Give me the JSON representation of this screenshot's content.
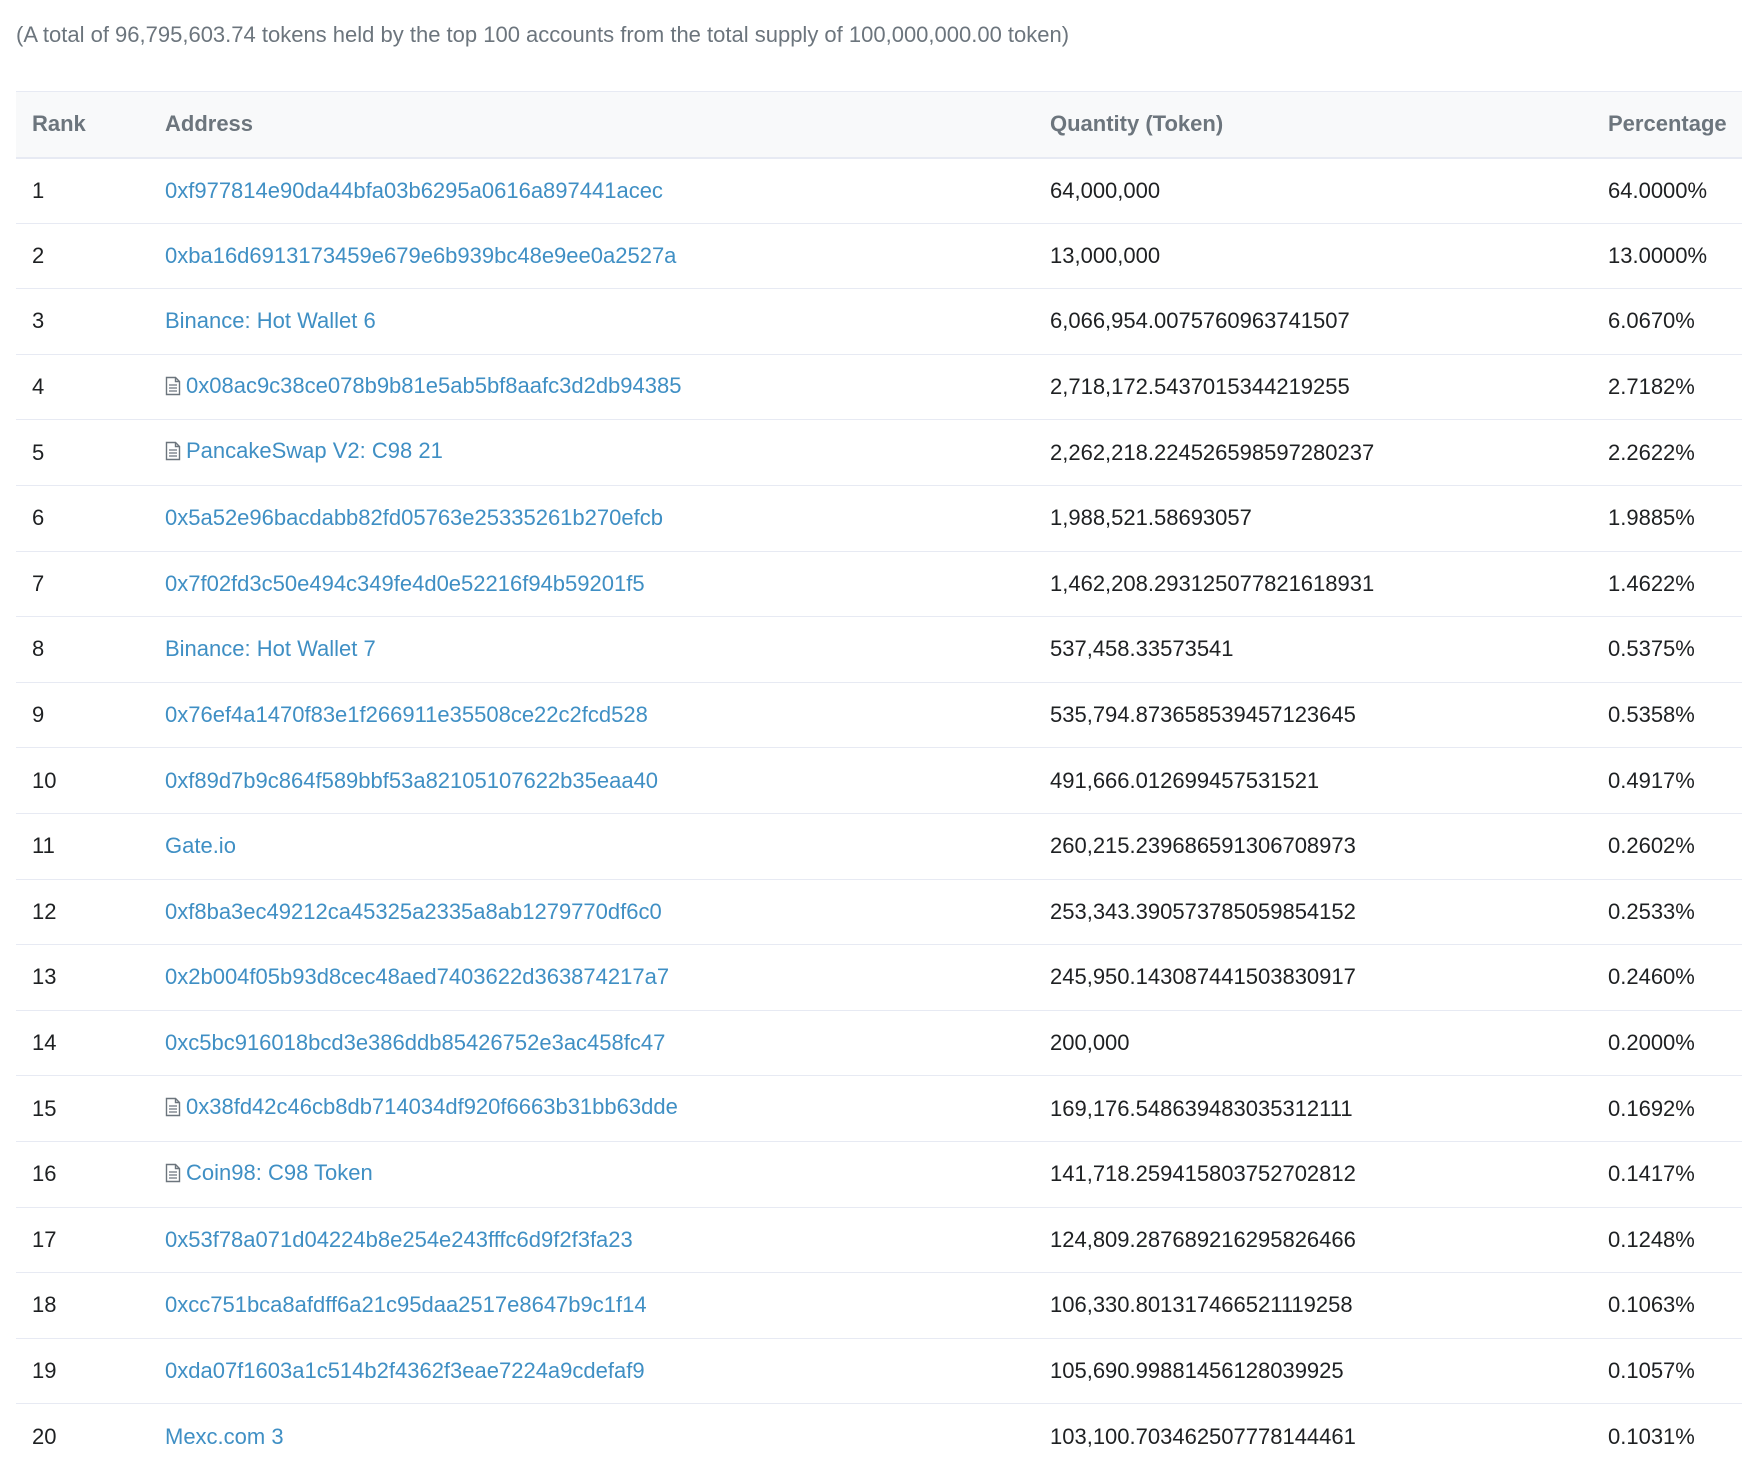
{
  "summary": "(A total of 96,795,603.74 tokens held by the top 100 accounts from the total supply of 100,000,000.00 token)",
  "colors": {
    "link": "#3f8fc4",
    "header_bg": "#f8f9fa",
    "muted_text": "#6c757d",
    "border": "#e7eaf3"
  },
  "table": {
    "headers": {
      "rank": "Rank",
      "address": "Address",
      "quantity": "Quantity (Token)",
      "percentage": "Percentage"
    },
    "rows": [
      {
        "rank": "1",
        "address": "0xf977814e90da44bfa03b6295a0616a897441acec",
        "is_contract": false,
        "quantity": "64,000,000",
        "percentage": "64.0000%"
      },
      {
        "rank": "2",
        "address": "0xba16d6913173459e679e6b939bc48e9ee0a2527a",
        "is_contract": false,
        "quantity": "13,000,000",
        "percentage": "13.0000%"
      },
      {
        "rank": "3",
        "address": "Binance: Hot Wallet 6",
        "is_contract": false,
        "quantity": "6,066,954.0075760963741507",
        "percentage": "6.0670%"
      },
      {
        "rank": "4",
        "address": "0x08ac9c38ce078b9b81e5ab5bf8aafc3d2db94385",
        "is_contract": true,
        "quantity": "2,718,172.5437015344219255",
        "percentage": "2.7182%"
      },
      {
        "rank": "5",
        "address": "PancakeSwap V2: C98 21",
        "is_contract": true,
        "quantity": "2,262,218.224526598597280237",
        "percentage": "2.2622%"
      },
      {
        "rank": "6",
        "address": "0x5a52e96bacdabb82fd05763e25335261b270efcb",
        "is_contract": false,
        "quantity": "1,988,521.58693057",
        "percentage": "1.9885%"
      },
      {
        "rank": "7",
        "address": "0x7f02fd3c50e494c349fe4d0e52216f94b59201f5",
        "is_contract": false,
        "quantity": "1,462,208.293125077821618931",
        "percentage": "1.4622%"
      },
      {
        "rank": "8",
        "address": "Binance: Hot Wallet 7",
        "is_contract": false,
        "quantity": "537,458.33573541",
        "percentage": "0.5375%"
      },
      {
        "rank": "9",
        "address": "0x76ef4a1470f83e1f266911e35508ce22c2fcd528",
        "is_contract": false,
        "quantity": "535,794.873658539457123645",
        "percentage": "0.5358%"
      },
      {
        "rank": "10",
        "address": "0xf89d7b9c864f589bbf53a82105107622b35eaa40",
        "is_contract": false,
        "quantity": "491,666.012699457531521",
        "percentage": "0.4917%"
      },
      {
        "rank": "11",
        "address": "Gate.io",
        "is_contract": false,
        "quantity": "260,215.239686591306708973",
        "percentage": "0.2602%"
      },
      {
        "rank": "12",
        "address": "0xf8ba3ec49212ca45325a2335a8ab1279770df6c0",
        "is_contract": false,
        "quantity": "253,343.390573785059854152",
        "percentage": "0.2533%"
      },
      {
        "rank": "13",
        "address": "0x2b004f05b93d8cec48aed7403622d363874217a7",
        "is_contract": false,
        "quantity": "245,950.143087441503830917",
        "percentage": "0.2460%"
      },
      {
        "rank": "14",
        "address": "0xc5bc916018bcd3e386ddb85426752e3ac458fc47",
        "is_contract": false,
        "quantity": "200,000",
        "percentage": "0.2000%"
      },
      {
        "rank": "15",
        "address": "0x38fd42c46cb8db714034df920f6663b31bb63dde",
        "is_contract": true,
        "quantity": "169,176.548639483035312111",
        "percentage": "0.1692%"
      },
      {
        "rank": "16",
        "address": "Coin98: C98 Token",
        "is_contract": true,
        "quantity": "141,718.259415803752702812",
        "percentage": "0.1417%"
      },
      {
        "rank": "17",
        "address": "0x53f78a071d04224b8e254e243fffc6d9f2f3fa23",
        "is_contract": false,
        "quantity": "124,809.287689216295826466",
        "percentage": "0.1248%"
      },
      {
        "rank": "18",
        "address": "0xcc751bca8afdff6a21c95daa2517e8647b9c1f14",
        "is_contract": false,
        "quantity": "106,330.801317466521119258",
        "percentage": "0.1063%"
      },
      {
        "rank": "19",
        "address": "0xda07f1603a1c514b2f4362f3eae7224a9cdefaf9",
        "is_contract": false,
        "quantity": "105,690.99881456128039925",
        "percentage": "0.1057%"
      },
      {
        "rank": "20",
        "address": "Mexc.com 3",
        "is_contract": false,
        "quantity": "103,100.703462507778144461",
        "percentage": "0.1031%"
      }
    ]
  }
}
